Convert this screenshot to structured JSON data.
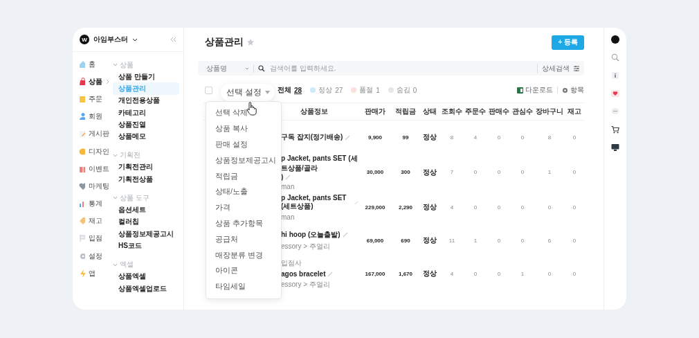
{
  "brand": {
    "logo": "W",
    "name": "아임부스터"
  },
  "nav": [
    {
      "label": "홈",
      "selected": false
    },
    {
      "label": "상품",
      "selected": true
    },
    {
      "label": "주문",
      "selected": false
    },
    {
      "label": "회원",
      "selected": false
    },
    {
      "label": "게시판",
      "selected": false
    },
    {
      "label": "디자인",
      "selected": false
    },
    {
      "label": "이벤트",
      "selected": false
    },
    {
      "label": "마케팅",
      "selected": false
    },
    {
      "label": "통계",
      "selected": false
    },
    {
      "label": "재고",
      "selected": false
    },
    {
      "label": "입점",
      "selected": false
    },
    {
      "label": "설정",
      "selected": false
    },
    {
      "label": "앱",
      "selected": false
    }
  ],
  "submenu": [
    {
      "title": "상품",
      "expanded": true,
      "items": [
        {
          "label": "상품 만들기",
          "selected": false
        },
        {
          "label": "상품관리",
          "selected": true
        },
        {
          "label": "개인전용상품",
          "selected": false
        },
        {
          "label": "카테고리",
          "selected": false
        },
        {
          "label": "상품진열",
          "selected": false
        },
        {
          "label": "상품메모",
          "selected": false
        }
      ]
    },
    {
      "title": "기획전",
      "expanded": true,
      "items": [
        {
          "label": "기획전관리",
          "selected": false
        },
        {
          "label": "기획전상품",
          "selected": false
        }
      ]
    },
    {
      "title": "상품 도구",
      "expanded": true,
      "items": [
        {
          "label": "옵션세트",
          "selected": false
        },
        {
          "label": "컬러칩",
          "selected": false
        },
        {
          "label": "상품정보제공고시",
          "selected": false
        },
        {
          "label": "HS코드",
          "selected": false
        }
      ]
    },
    {
      "title": "엑셀",
      "expanded": true,
      "items": [
        {
          "label": "상품엑셀",
          "selected": false
        },
        {
          "label": "상품엑셀업로드",
          "selected": false
        }
      ]
    }
  ],
  "page": {
    "title": "상품관리",
    "register_button": "+ 등록"
  },
  "search": {
    "field": "상품명",
    "placeholder": "검색어를 입력하세요.",
    "advanced": "상세검색"
  },
  "select_all": {
    "checked": false
  },
  "selection_popover": "선택 설정",
  "filters": [
    {
      "kind": "total",
      "label": "전체",
      "count": "28"
    },
    {
      "kind": "status",
      "label": "정상",
      "count": "27",
      "color": "#cdeafb"
    },
    {
      "kind": "status",
      "label": "품절",
      "count": "1",
      "color": "#fde0dc"
    },
    {
      "kind": "status",
      "label": "숨김",
      "count": "0",
      "color": "#e4e6e9"
    }
  ],
  "tools": {
    "download": "다운로드",
    "columns": "항목"
  },
  "table": {
    "product_column": "상품정보",
    "columns": [
      "판매가",
      "적립금",
      "상태",
      "조회수",
      "주문수",
      "판매수",
      "관심수",
      "장바구니",
      "재고"
    ],
    "rows": [
      {
        "seller": null,
        "name_lines": [
          "구독 잡지(정기배송)"
        ],
        "category": null,
        "cells": [
          "9,900",
          "99",
          "정상",
          "8",
          "4",
          "0",
          "0",
          "8",
          "0"
        ]
      },
      {
        "seller": null,
        "name_lines": [
          "p Jacket, pants SET (세트상품/골라",
          ")"
        ],
        "category": "man",
        "cells": [
          "30,000",
          "300",
          "정상",
          "7",
          "0",
          "0",
          "0",
          "1",
          "0"
        ]
      },
      {
        "seller": null,
        "name_lines": [
          "p Jacket, pants SET (세트상품)"
        ],
        "category": "man",
        "cells": [
          "229,000",
          "2,290",
          "정상",
          "4",
          "0",
          "0",
          "0",
          "0",
          "0"
        ]
      },
      {
        "seller": null,
        "name_lines": [
          "hi hoop (오늘출발)"
        ],
        "category": "essory > 주얼리",
        "cells": [
          "69,000",
          "690",
          "정상",
          "11",
          "1",
          "0",
          "0",
          "6",
          "0"
        ]
      },
      {
        "seller": "입점사",
        "name_lines": [
          "agos bracelet"
        ],
        "category": "essory > 주얼리",
        "cells": [
          "167,000",
          "1,670",
          "정상",
          "4",
          "0",
          "0",
          "1",
          "0",
          "0"
        ]
      }
    ]
  },
  "dropdown": [
    "선택 삭제",
    "상품 복사",
    "판매 설정",
    "상품정보제공고시",
    "적립금",
    "상태/노출",
    "가격",
    "상품 추가항목",
    "공급처",
    "매장분류 변경",
    "아이콘",
    "타임세일"
  ]
}
